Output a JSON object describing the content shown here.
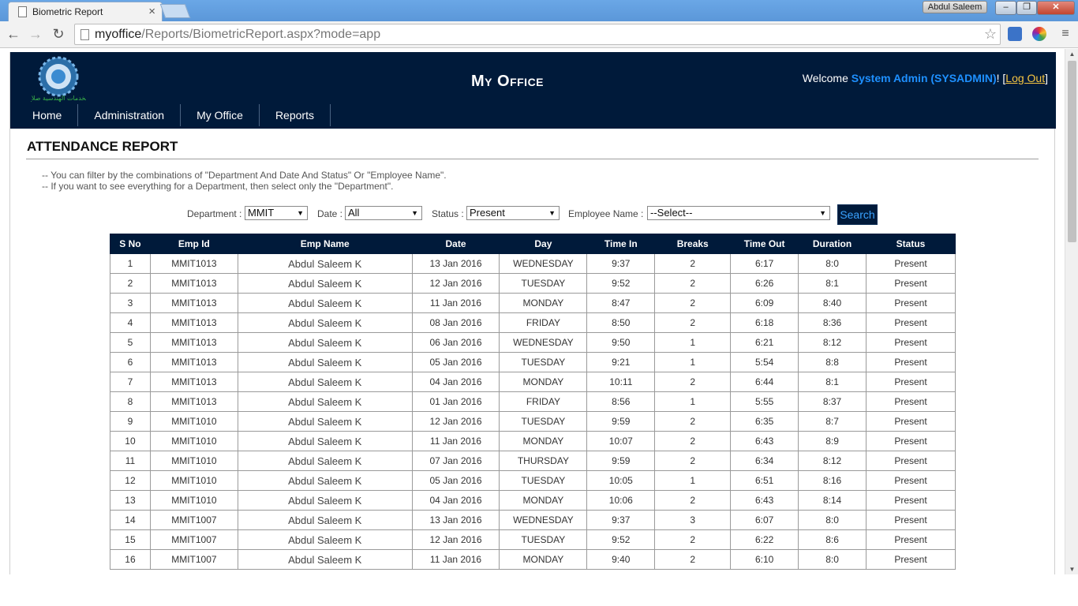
{
  "browser": {
    "tab_title": "Biometric Report",
    "url_host": "myoffice",
    "url_path": "/Reports/BiometricReport.aspx?mode=app",
    "os_user": "Abdul Saleem"
  },
  "header": {
    "site_title": "My Office",
    "welcome_prefix": "Welcome ",
    "user_name": "System Admin (SYSADMIN)",
    "welcome_mid": "! [",
    "logout_label": "Log Out",
    "welcome_suffix": "]",
    "logo_text": "الخدمات الهندسية صلاح"
  },
  "menu": [
    {
      "label": "Home"
    },
    {
      "label": "Administration"
    },
    {
      "label": "My Office"
    },
    {
      "label": "Reports"
    }
  ],
  "report": {
    "title": "ATTENDANCE REPORT",
    "hint1": "-- You can filter by the combinations of \"Department And Date And Status\" Or \"Employee Name\".",
    "hint2": "-- If you want to see everything for a Department, then select only the \"Department\"."
  },
  "filters": {
    "department_label": "Department :",
    "department_value": "MMIT",
    "date_label": "Date :",
    "date_value": "All",
    "status_label": "Status :",
    "status_value": "Present",
    "employee_label": "Employee Name :",
    "employee_value": "--Select--",
    "search_label": "Search"
  },
  "table": {
    "headers": [
      "S No",
      "Emp Id",
      "Emp Name",
      "Date",
      "Day",
      "Time In",
      "Breaks",
      "Time Out",
      "Duration",
      "Status"
    ],
    "rows": [
      [
        "1",
        "MMIT1013",
        "Abdul Saleem K",
        "13 Jan 2016",
        "WEDNESDAY",
        "9:37",
        "2",
        "6:17",
        "8:0",
        "Present"
      ],
      [
        "2",
        "MMIT1013",
        "Abdul Saleem K",
        "12 Jan 2016",
        "TUESDAY",
        "9:52",
        "2",
        "6:26",
        "8:1",
        "Present"
      ],
      [
        "3",
        "MMIT1013",
        "Abdul Saleem K",
        "11 Jan 2016",
        "MONDAY",
        "8:47",
        "2",
        "6:09",
        "8:40",
        "Present"
      ],
      [
        "4",
        "MMIT1013",
        "Abdul Saleem K",
        "08 Jan 2016",
        "FRIDAY",
        "8:50",
        "2",
        "6:18",
        "8:36",
        "Present"
      ],
      [
        "5",
        "MMIT1013",
        "Abdul Saleem K",
        "06 Jan 2016",
        "WEDNESDAY",
        "9:50",
        "1",
        "6:21",
        "8:12",
        "Present"
      ],
      [
        "6",
        "MMIT1013",
        "Abdul Saleem K",
        "05 Jan 2016",
        "TUESDAY",
        "9:21",
        "1",
        "5:54",
        "8:8",
        "Present"
      ],
      [
        "7",
        "MMIT1013",
        "Abdul Saleem K",
        "04 Jan 2016",
        "MONDAY",
        "10:11",
        "2",
        "6:44",
        "8:1",
        "Present"
      ],
      [
        "8",
        "MMIT1013",
        "Abdul Saleem K",
        "01 Jan 2016",
        "FRIDAY",
        "8:56",
        "1",
        "5:55",
        "8:37",
        "Present"
      ],
      [
        "9",
        "MMIT1010",
        "Abdul Saleem K",
        "12 Jan 2016",
        "TUESDAY",
        "9:59",
        "2",
        "6:35",
        "8:7",
        "Present"
      ],
      [
        "10",
        "MMIT1010",
        "Abdul Saleem K",
        "11 Jan 2016",
        "MONDAY",
        "10:07",
        "2",
        "6:43",
        "8:9",
        "Present"
      ],
      [
        "11",
        "MMIT1010",
        "Abdul Saleem K",
        "07 Jan 2016",
        "THURSDAY",
        "9:59",
        "2",
        "6:34",
        "8:12",
        "Present"
      ],
      [
        "12",
        "MMIT1010",
        "Abdul Saleem K",
        "05 Jan 2016",
        "TUESDAY",
        "10:05",
        "1",
        "6:51",
        "8:16",
        "Present"
      ],
      [
        "13",
        "MMIT1010",
        "Abdul Saleem K",
        "04 Jan 2016",
        "MONDAY",
        "10:06",
        "2",
        "6:43",
        "8:14",
        "Present"
      ],
      [
        "14",
        "MMIT1007",
        "Abdul Saleem K",
        "13 Jan 2016",
        "WEDNESDAY",
        "9:37",
        "3",
        "6:07",
        "8:0",
        "Present"
      ],
      [
        "15",
        "MMIT1007",
        "Abdul Saleem K",
        "12 Jan 2016",
        "TUESDAY",
        "9:52",
        "2",
        "6:22",
        "8:6",
        "Present"
      ],
      [
        "16",
        "MMIT1007",
        "Abdul Saleem K",
        "11 Jan 2016",
        "MONDAY",
        "9:40",
        "2",
        "6:10",
        "8:0",
        "Present"
      ]
    ]
  }
}
